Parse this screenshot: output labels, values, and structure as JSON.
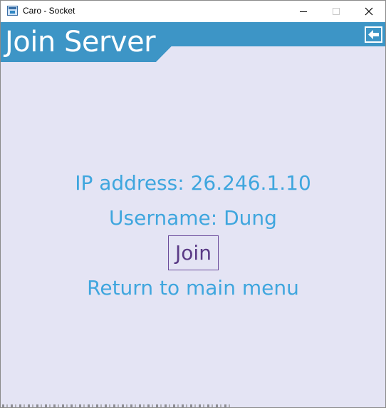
{
  "window": {
    "title": "Caro - Socket",
    "controls": {
      "minimize_icon": "minimize-icon",
      "maximize_icon": "maximize-icon",
      "close_icon": "close-icon"
    }
  },
  "header": {
    "title": "Join Server",
    "back_icon": "arrow-left-icon"
  },
  "menu": {
    "ip_address": "IP address: 26.246.1.10",
    "username": "Username: Dung",
    "join": "Join",
    "return": "Return to main menu"
  },
  "colors": {
    "background": "#e4e4f4",
    "header": "#3d95c6",
    "menu_text": "#3fa6de",
    "join_text": "#5a3a86"
  }
}
